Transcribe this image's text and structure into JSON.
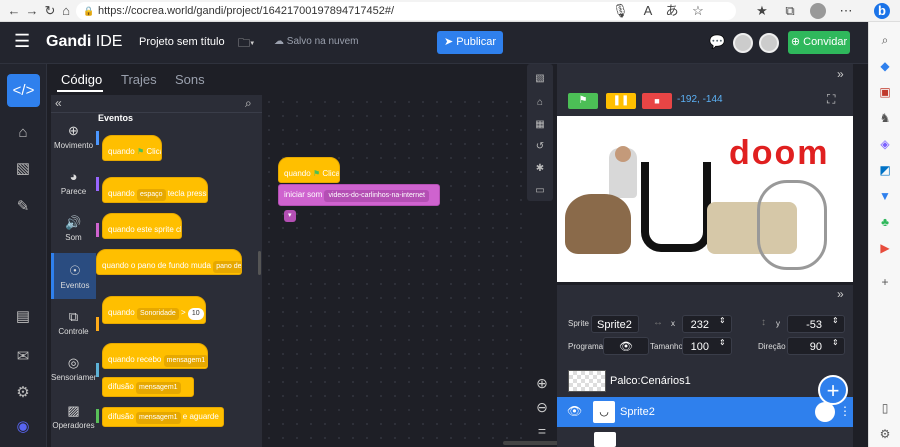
{
  "browser": {
    "url": "https://cocrea.world/gandi/project/16421700197894717452#/",
    "nav": [
      "←",
      "→",
      "↻",
      "⌂"
    ],
    "url_icon": "lock-icon",
    "extension_icons": [
      "mic-icon",
      "reader-icon",
      "translate-icon",
      "star-icon",
      "favorites-icon",
      "collections-icon",
      "profile-icon",
      "more-icon"
    ]
  },
  "app": {
    "logo_bold": "Gandi",
    "logo_light": "IDE",
    "project_title": "Projeto sem título",
    "saved_status": "Salvo na nuvem",
    "publish_label": "Publicar",
    "share_label": "Convidar"
  },
  "tabs": [
    "Código",
    "Trajes",
    "Sons"
  ],
  "categories": [
    {
      "label": "Movimento",
      "icon": "move-icon",
      "color": "#4c97ff"
    },
    {
      "label": "Parece",
      "icon": "looks-icon",
      "color": "#9966ff"
    },
    {
      "label": "Som",
      "icon": "sound-icon",
      "color": "#cf63cf"
    },
    {
      "label": "Eventos",
      "icon": "events-icon",
      "color": "#ffbf00"
    },
    {
      "label": "Controle",
      "icon": "control-icon",
      "color": "#ffab19"
    },
    {
      "label": "Sensoriamento",
      "icon": "sensing-icon",
      "color": "#5cb1d6"
    },
    {
      "label": "Operadores",
      "icon": "operators-icon",
      "color": "#59c059"
    }
  ],
  "palette": {
    "section": "Eventos",
    "blocks": {
      "flag_prefix": "quando",
      "flag_suffix": "Clicado",
      "key_prefix": "quando",
      "key_value": "espaço",
      "key_suffix": "tecla pressionada",
      "sprite_clicked": "quando este sprite clicou",
      "backdrop_prefix": "quando o pano de fundo muda",
      "backdrop_value": "pano de fundo1",
      "sensor_prefix": "quando",
      "sensor_value": "Sonoridade",
      "sensor_op": ">",
      "sensor_num": "10",
      "receive_prefix": "quando recebo",
      "receive_value": "mensagem1",
      "broadcast_prefix": "difusão",
      "broadcast_value": "mensagem1",
      "broadcast_wait_prefix": "difusão",
      "broadcast_wait_value": "mensagem1",
      "broadcast_wait_suffix": "e aguarde"
    }
  },
  "script": {
    "hat_prefix": "quando",
    "hat_suffix": "Clicado",
    "sound_prefix": "iniciar som",
    "sound_value": "videos-do-carlinhos-na-internet"
  },
  "stage": {
    "coords": "-192, -144",
    "text_overlay": "doom"
  },
  "sprite_info": {
    "sprite_label": "Sprite",
    "sprite_name": "Sprite2",
    "x_label": "x",
    "x_value": "232",
    "y_label": "y",
    "y_value": "-53",
    "program_label": "Programa",
    "size_label": "Tamanho",
    "size_value": "100",
    "direction_label": "Direção",
    "direction_value": "90"
  },
  "sprite_list": {
    "stage_label": "Palco:Cenários1",
    "selected_sprite": "Sprite2"
  },
  "colors": {
    "accent": "#2f80ed",
    "share": "#2fb85c",
    "event": "#ffbf00",
    "sound": "#cf63cf"
  }
}
